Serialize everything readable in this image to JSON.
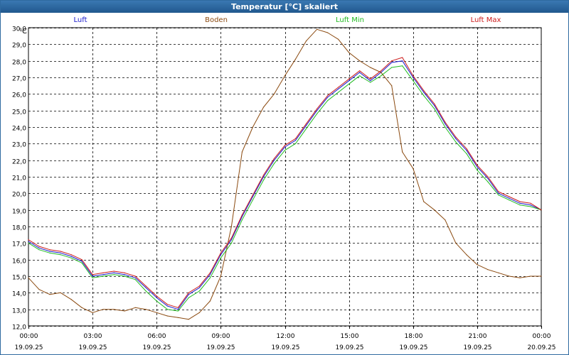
{
  "window": {
    "title": "Temperatur [°C] skaliert"
  },
  "chart_data": {
    "type": "line",
    "title": "Temperatur [°C] skaliert",
    "ylabel": "°C",
    "xlabel": "",
    "ylim": [
      12.0,
      30.0
    ],
    "xlim": [
      0,
      24
    ],
    "grid": true,
    "legend_placement": "top",
    "y_ticks": [
      "12,0",
      "13,0",
      "14,0",
      "15,0",
      "16,0",
      "17,0",
      "18,0",
      "19,0",
      "20,0",
      "21,0",
      "22,0",
      "23,0",
      "24,0",
      "25,0",
      "26,0",
      "27,0",
      "28,0",
      "29,0",
      "30,0"
    ],
    "x_ticks": [
      {
        "time": "00:00",
        "date": "19.09.25"
      },
      {
        "time": "03:00",
        "date": "19.09.25"
      },
      {
        "time": "06:00",
        "date": "19.09.25"
      },
      {
        "time": "09:00",
        "date": "19.09.25"
      },
      {
        "time": "12:00",
        "date": "19.09.25"
      },
      {
        "time": "15:00",
        "date": "19.09.25"
      },
      {
        "time": "18:00",
        "date": "19.09.25"
      },
      {
        "time": "21:00",
        "date": "19.09.25"
      },
      {
        "time": "00:00",
        "date": "20.09.25"
      }
    ],
    "series": [
      {
        "name": "Luft",
        "color": "#1a1acc",
        "x": [
          0,
          0.5,
          1,
          1.5,
          2,
          2.5,
          3,
          3.5,
          4,
          4.5,
          5,
          5.5,
          6,
          6.5,
          7,
          7.5,
          8,
          8.5,
          9,
          9.5,
          10,
          10.5,
          11,
          11.5,
          12,
          12.5,
          13,
          13.5,
          14,
          14.5,
          15,
          15.5,
          16,
          16.5,
          17,
          17.5,
          18,
          18.5,
          19,
          19.5,
          20,
          20.5,
          21,
          21.5,
          22,
          22.5,
          23,
          23.5,
          24
        ],
        "values": [
          17.1,
          16.7,
          16.5,
          16.4,
          16.2,
          15.9,
          15.0,
          15.1,
          15.2,
          15.1,
          14.9,
          14.3,
          13.7,
          13.2,
          13.0,
          13.9,
          14.3,
          15.1,
          16.3,
          17.2,
          18.6,
          19.8,
          21.0,
          22.0,
          22.8,
          23.2,
          24.1,
          25.0,
          25.8,
          26.3,
          26.8,
          27.3,
          26.8,
          27.3,
          27.9,
          28.0,
          27.0,
          26.1,
          25.3,
          24.2,
          23.3,
          22.6,
          21.6,
          20.9,
          20.0,
          19.7,
          19.4,
          19.3,
          19.0
        ]
      },
      {
        "name": "Boden",
        "color": "#8b4a10",
        "x": [
          0,
          0.5,
          1,
          1.5,
          2,
          2.5,
          3,
          3.5,
          4,
          4.5,
          5,
          5.5,
          6,
          6.5,
          7,
          7.5,
          8,
          8.5,
          9,
          9.5,
          10,
          10.5,
          11,
          11.5,
          12,
          12.5,
          13,
          13.5,
          14,
          14.5,
          15,
          15.5,
          16,
          16.5,
          17,
          17.5,
          18,
          18.5,
          19,
          19.5,
          20,
          20.5,
          21,
          21.5,
          22,
          22.5,
          23,
          23.5,
          24
        ],
        "values": [
          14.9,
          14.2,
          13.9,
          14.0,
          13.6,
          13.1,
          12.8,
          13.0,
          13.0,
          12.9,
          13.1,
          13.0,
          12.8,
          12.6,
          12.5,
          12.4,
          12.8,
          13.5,
          15.0,
          18.0,
          22.5,
          24.0,
          25.2,
          26.0,
          27.1,
          28.1,
          29.2,
          29.9,
          29.7,
          29.3,
          28.5,
          28.0,
          27.6,
          27.3,
          26.5,
          22.5,
          21.5,
          19.5,
          19.0,
          18.4,
          17.0,
          16.3,
          15.7,
          15.4,
          15.2,
          15.0,
          14.9,
          15.0,
          15.0
        ]
      },
      {
        "name": "Luft Min",
        "color": "#22bb22",
        "x": [
          0,
          0.5,
          1,
          1.5,
          2,
          2.5,
          3,
          3.5,
          4,
          4.5,
          5,
          5.5,
          6,
          6.5,
          7,
          7.5,
          8,
          8.5,
          9,
          9.5,
          10,
          10.5,
          11,
          11.5,
          12,
          12.5,
          13,
          13.5,
          14,
          14.5,
          15,
          15.5,
          16,
          16.5,
          17,
          17.5,
          18,
          18.5,
          19,
          19.5,
          20,
          20.5,
          21,
          21.5,
          22,
          22.5,
          23,
          23.5,
          24
        ],
        "values": [
          17.0,
          16.6,
          16.4,
          16.3,
          16.1,
          15.8,
          14.9,
          15.0,
          15.1,
          15.0,
          14.8,
          14.1,
          13.5,
          13.0,
          12.9,
          13.7,
          14.1,
          14.9,
          16.1,
          17.0,
          18.4,
          19.6,
          20.8,
          21.8,
          22.6,
          23.0,
          23.9,
          24.8,
          25.6,
          26.1,
          26.6,
          27.1,
          26.7,
          27.1,
          27.6,
          27.7,
          26.8,
          25.9,
          25.1,
          24.0,
          23.1,
          22.4,
          21.4,
          20.7,
          19.9,
          19.6,
          19.3,
          19.2,
          19.0
        ]
      },
      {
        "name": "Luft Max",
        "color": "#cc1a1a",
        "x": [
          0,
          0.5,
          1,
          1.5,
          2,
          2.5,
          3,
          3.5,
          4,
          4.5,
          5,
          5.5,
          6,
          6.5,
          7,
          7.5,
          8,
          8.5,
          9,
          9.5,
          10,
          10.5,
          11,
          11.5,
          12,
          12.5,
          13,
          13.5,
          14,
          14.5,
          15,
          15.5,
          16,
          16.5,
          17,
          17.5,
          18,
          18.5,
          19,
          19.5,
          20,
          20.5,
          21,
          21.5,
          22,
          22.5,
          23,
          23.5,
          24
        ],
        "values": [
          17.2,
          16.8,
          16.6,
          16.5,
          16.3,
          16.0,
          15.1,
          15.2,
          15.3,
          15.2,
          15.0,
          14.4,
          13.8,
          13.3,
          13.1,
          14.0,
          14.4,
          15.2,
          16.4,
          17.3,
          18.7,
          19.9,
          21.1,
          22.1,
          22.9,
          23.3,
          24.2,
          25.1,
          25.9,
          26.4,
          26.9,
          27.4,
          26.9,
          27.4,
          28.0,
          28.2,
          27.1,
          26.2,
          25.4,
          24.3,
          23.4,
          22.7,
          21.7,
          21.0,
          20.1,
          19.8,
          19.5,
          19.4,
          19.0
        ]
      }
    ]
  }
}
